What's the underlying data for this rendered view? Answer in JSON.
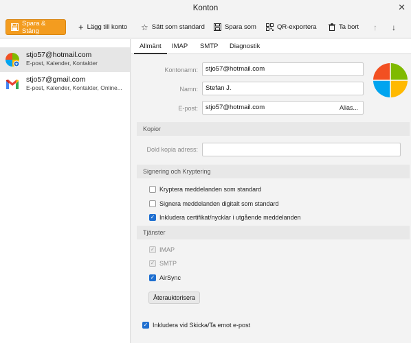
{
  "window": {
    "title": "Konton"
  },
  "toolbar": {
    "save_close": "Spara & Stäng",
    "add_account": "Lägg till konto",
    "set_default": "Sätt som standard",
    "save_as": "Spara som",
    "qr_export": "QR-exportera",
    "delete": "Ta bort"
  },
  "accounts": [
    {
      "email": "stjo57@hotmail.com",
      "sub": "E-post, Kalender, Kontakter",
      "icon": "outlook-icon"
    },
    {
      "email": "stjo57@gmail.com",
      "sub": "E-post, Kalender, Kontakter, Online...",
      "icon": "gmail-icon"
    }
  ],
  "tabs": [
    "Allmänt",
    "IMAP",
    "SMTP",
    "Diagnostik"
  ],
  "general": {
    "account_name_label": "Kontonamn:",
    "account_name": "stjo57@hotmail.com",
    "name_label": "Namn:",
    "name": "Stefan J.",
    "email_label": "E-post:",
    "email": "stjo57@hotmail.com",
    "alias": "Alias..."
  },
  "copies": {
    "header": "Kopior",
    "bcc_label": "Dold kopia adress:",
    "bcc_value": ""
  },
  "signing": {
    "header": "Signering och Kryptering",
    "encrypt": "Kryptera meddelanden som standard",
    "sign": "Signera meddelanden digitalt som standard",
    "include_cert": "Inkludera certifikat/nycklar i utgående meddelanden"
  },
  "services": {
    "header": "Tjänster",
    "imap": "IMAP",
    "smtp": "SMTP",
    "airsync": "AirSync",
    "reauth": "Återauktorisera"
  },
  "footer": {
    "include_send_receive": "Inkludera vid Skicka/Ta emot e-post"
  },
  "colors": {
    "accent": "#f39c1f",
    "check": "#1f6fd0"
  }
}
